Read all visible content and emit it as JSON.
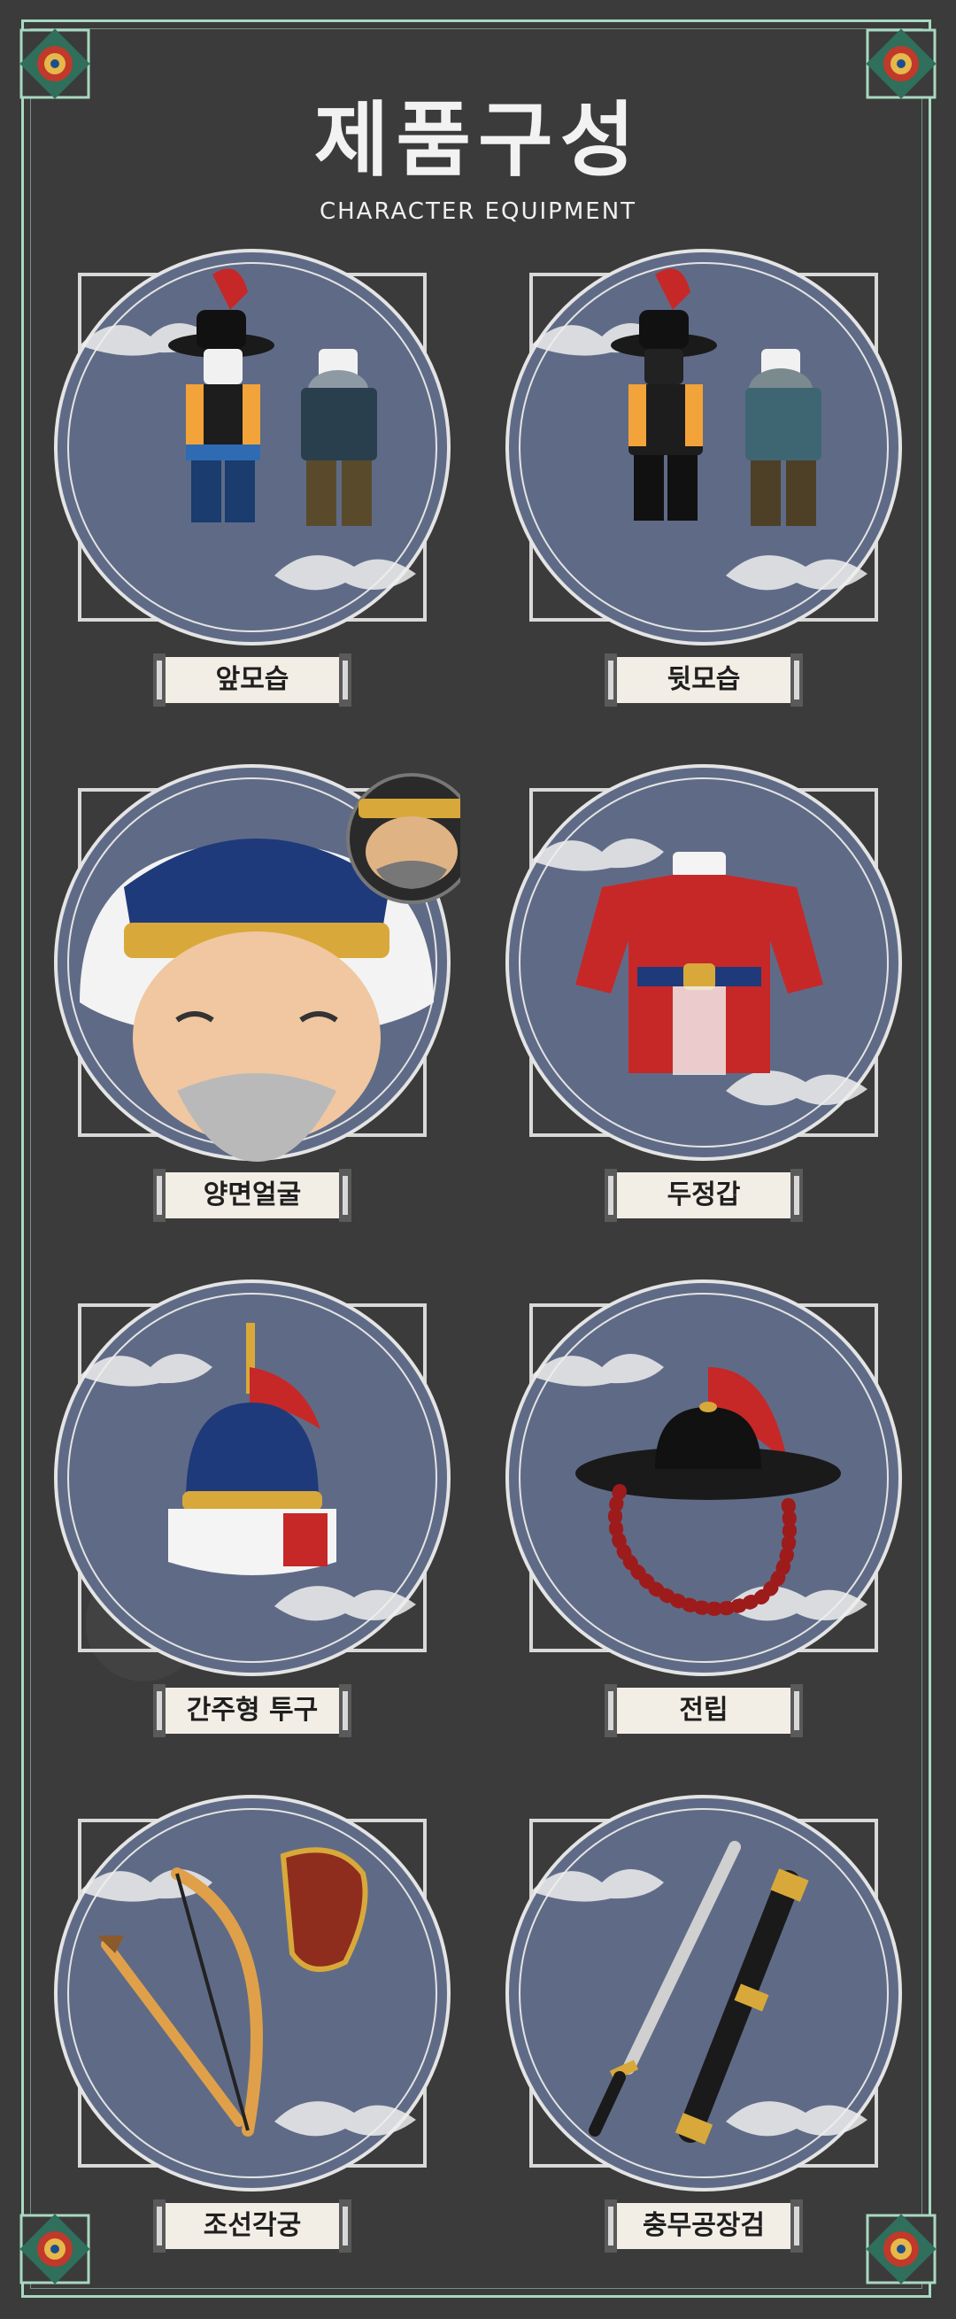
{
  "header": {
    "title": "제품구성",
    "subtitle": "CHARACTER EQUIPMENT"
  },
  "colors": {
    "background": "#3b3b3b",
    "frame": "#a9d8c2",
    "medallion": "#5f6b86",
    "label_bg": "#f2eee6"
  },
  "items": [
    {
      "label": "앞모습",
      "icon": "front-view-figure-icon"
    },
    {
      "label": "뒷모습",
      "icon": "back-view-figure-icon"
    },
    {
      "label": "양면얼굴",
      "icon": "double-sided-face-icon"
    },
    {
      "label": "두정갑",
      "icon": "armor-coat-icon"
    },
    {
      "label": "간주형 투구",
      "icon": "helmet-icon"
    },
    {
      "label": "전립",
      "icon": "jeollip-hat-icon"
    },
    {
      "label": "조선각궁",
      "icon": "bow-arrow-quiver-icon"
    },
    {
      "label": "충무공장검",
      "icon": "long-sword-icon"
    }
  ]
}
